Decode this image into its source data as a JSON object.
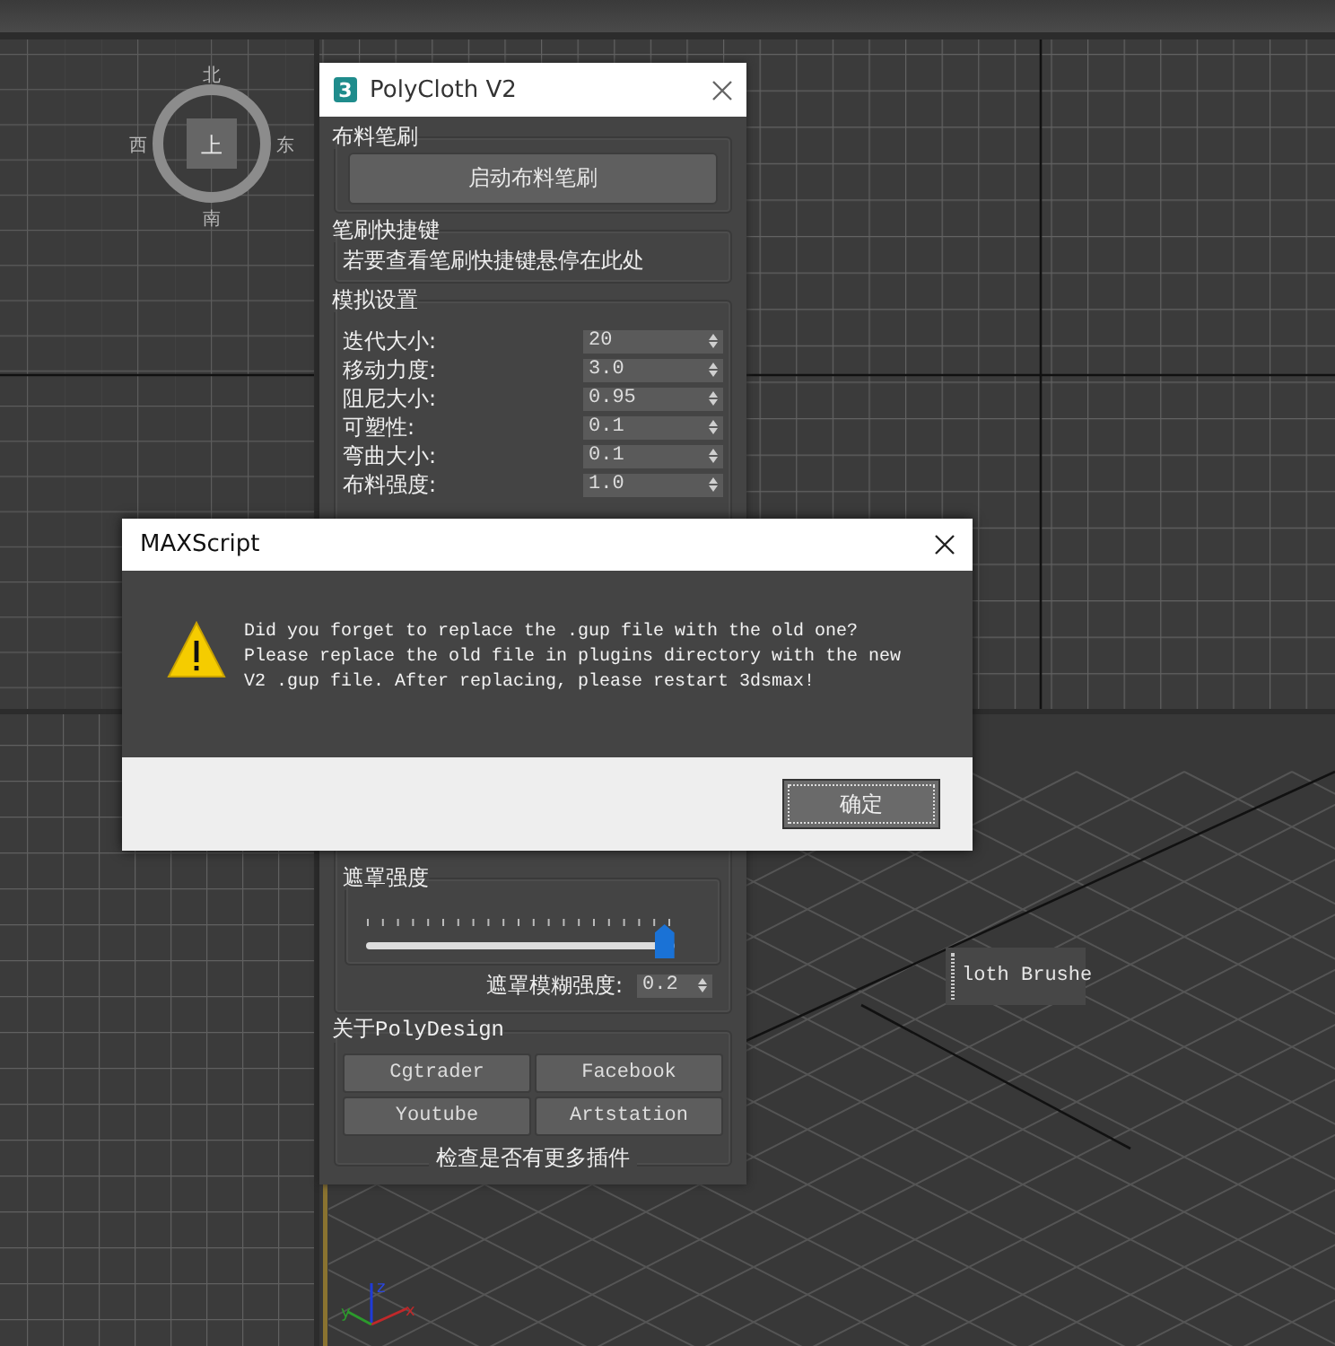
{
  "viewport": {
    "viewcube": {
      "top": "上",
      "north": "北",
      "west": "西",
      "east": "东",
      "south": "南"
    },
    "axis_gizmo": {
      "x": "x",
      "y": "y",
      "z": "z"
    }
  },
  "toolbar": {
    "label": "loth Brushe"
  },
  "panel": {
    "logo": "3",
    "title": "PolyCloth V2",
    "cloth_brush": {
      "heading": "布料笔刷",
      "button": "启动布料笔刷"
    },
    "shortcuts": {
      "heading": "笔刷快捷键",
      "hint": "若要查看笔刷快捷键悬停在此处"
    },
    "simulation": {
      "heading": "模拟设置",
      "params": [
        {
          "label": "迭代大小:",
          "value": "20"
        },
        {
          "label": "移动力度:",
          "value": "3.0"
        },
        {
          "label": "阻尼大小:",
          "value": "0.95"
        },
        {
          "label": "可塑性:",
          "value": "0.1"
        },
        {
          "label": "弯曲大小:",
          "value": "0.1"
        },
        {
          "label": "布料强度:",
          "value": "1.0"
        }
      ]
    },
    "mask": {
      "heading": "遮罩强度",
      "level": 0.97,
      "blur_label": "遮罩模糊强度:",
      "blur_value": "0.2"
    },
    "about": {
      "heading": "关于PolyDesign",
      "links": [
        "Cgtrader",
        "Facebook",
        "Youtube",
        "Artstation"
      ],
      "check_updates": "检查是否有更多插件"
    }
  },
  "dialog": {
    "title": "MAXScript",
    "message": "Did you forget to replace the .gup file with the old one?\nPlease replace the old file in plugins directory with the new\nV2 .gup file. After replacing, please restart 3dsmax!",
    "button": "确定"
  }
}
